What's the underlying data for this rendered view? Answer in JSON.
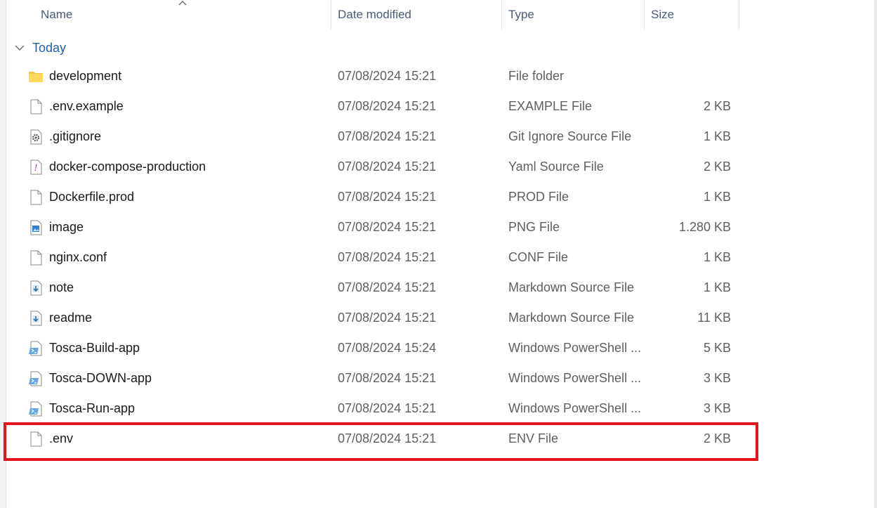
{
  "columns": {
    "name": "Name",
    "date_modified": "Date modified",
    "type": "Type",
    "size": "Size"
  },
  "sort": {
    "column": "name",
    "icon": "chevron-up-icon"
  },
  "group": {
    "label": "Today",
    "icon": "chevron-down-icon"
  },
  "files": [
    {
      "name": "development",
      "date": "07/08/2024 15:21",
      "type": "File folder",
      "size": "",
      "icon": "folder-icon"
    },
    {
      "name": ".env.example",
      "date": "07/08/2024 15:21",
      "type": "EXAMPLE File",
      "size": "2 KB",
      "icon": "blank-file-icon"
    },
    {
      "name": ".gitignore",
      "date": "07/08/2024 15:21",
      "type": "Git Ignore Source File",
      "size": "1 KB",
      "icon": "gear-file-icon"
    },
    {
      "name": "docker-compose-production",
      "date": "07/08/2024 15:21",
      "type": "Yaml Source File",
      "size": "2 KB",
      "icon": "yaml-file-icon"
    },
    {
      "name": "Dockerfile.prod",
      "date": "07/08/2024 15:21",
      "type": "PROD File",
      "size": "1 KB",
      "icon": "blank-file-icon"
    },
    {
      "name": "image",
      "date": "07/08/2024 15:21",
      "type": "PNG File",
      "size": "1.280 KB",
      "icon": "image-file-icon"
    },
    {
      "name": "nginx.conf",
      "date": "07/08/2024 15:21",
      "type": "CONF File",
      "size": "1 KB",
      "icon": "blank-file-icon"
    },
    {
      "name": "note",
      "date": "07/08/2024 15:21",
      "type": "Markdown Source File",
      "size": "1 KB",
      "icon": "markdown-file-icon"
    },
    {
      "name": "readme",
      "date": "07/08/2024 15:21",
      "type": "Markdown Source File",
      "size": "11 KB",
      "icon": "markdown-file-icon"
    },
    {
      "name": "Tosca-Build-app",
      "date": "07/08/2024 15:24",
      "type": "Windows PowerShell ...",
      "size": "5 KB",
      "icon": "powershell-file-icon"
    },
    {
      "name": "Tosca-DOWN-app",
      "date": "07/08/2024 15:21",
      "type": "Windows PowerShell ...",
      "size": "3 KB",
      "icon": "powershell-file-icon"
    },
    {
      "name": "Tosca-Run-app",
      "date": "07/08/2024 15:21",
      "type": "Windows PowerShell ...",
      "size": "3 KB",
      "icon": "powershell-file-icon"
    },
    {
      "name": ".env",
      "date": "07/08/2024 15:21",
      "type": "ENV File",
      "size": "2 KB",
      "icon": "blank-file-icon"
    }
  ],
  "highlighted_file": ".env",
  "colors": {
    "highlight": "#e8141b",
    "group_label": "#2461a8",
    "header_text": "#4a5b76"
  }
}
